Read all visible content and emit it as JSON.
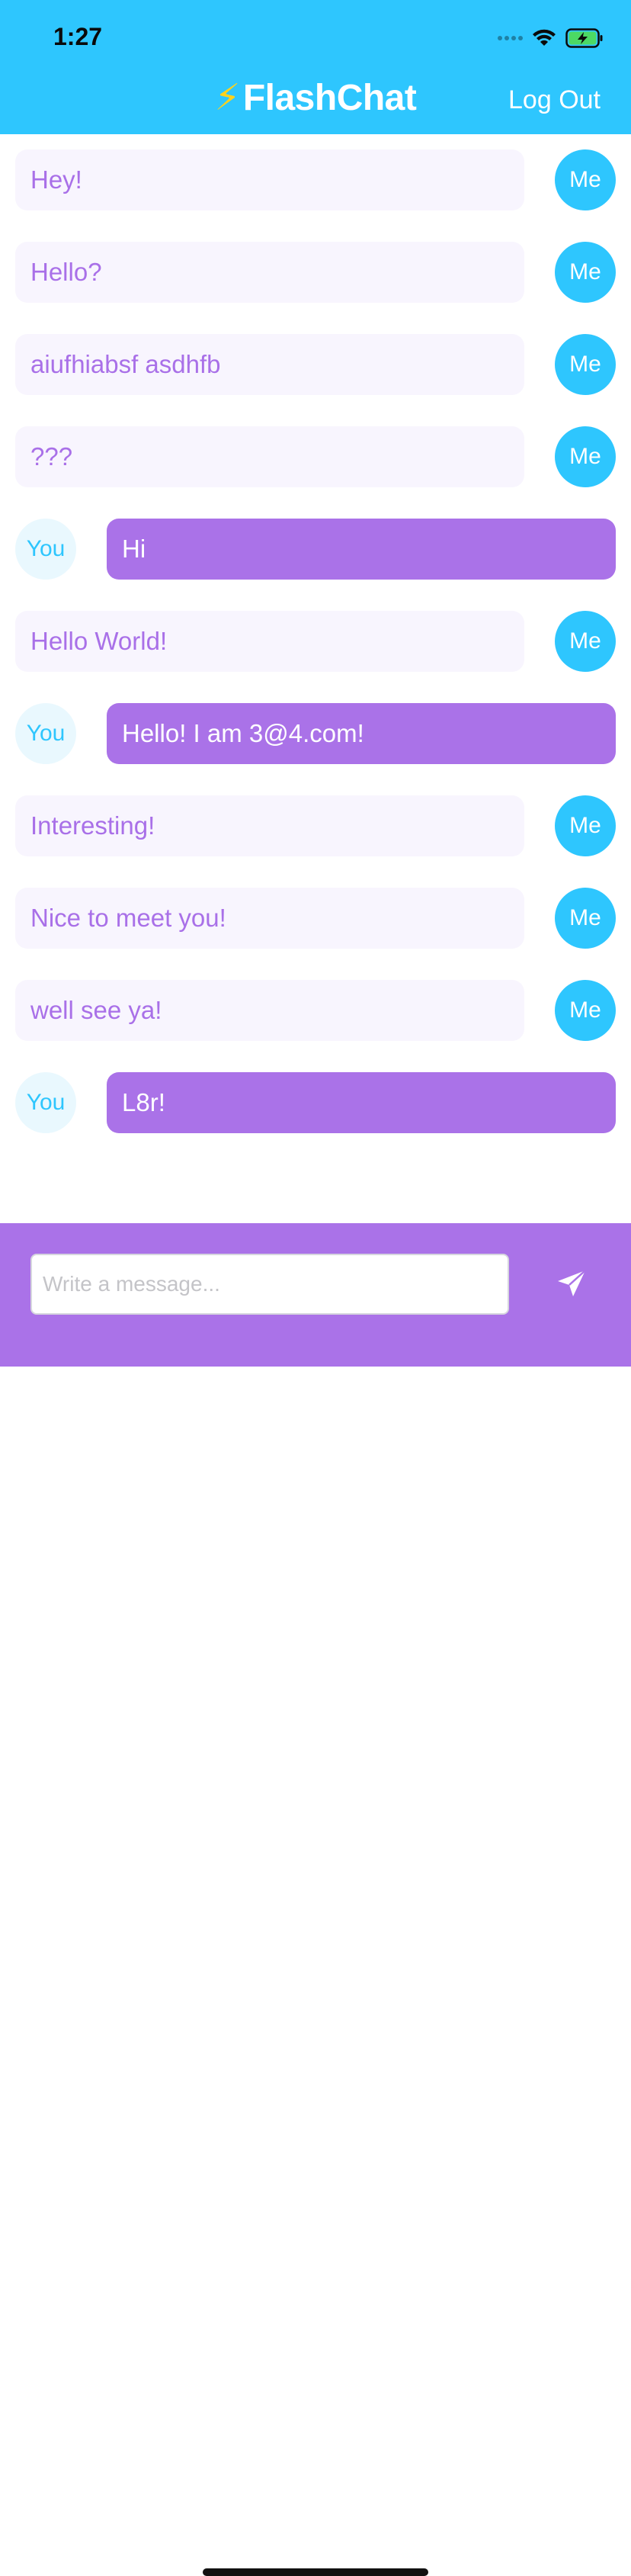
{
  "status_bar": {
    "time": "1:27",
    "icons": [
      "signal-icon",
      "wifi-icon",
      "battery-charging-icon"
    ]
  },
  "nav": {
    "title_icon": "⚡",
    "title": "FlashChat",
    "logout_label": "Log Out"
  },
  "colors": {
    "brand_blue": "#2ec6fe",
    "brand_purple": "#aa72e8",
    "bubble_light": "#f8f5fe",
    "title_bolt": "#ffd21c"
  },
  "messages": [
    {
      "sender": "me",
      "avatar": "Me",
      "text": "Hey!"
    },
    {
      "sender": "me",
      "avatar": "Me",
      "text": "Hello?"
    },
    {
      "sender": "me",
      "avatar": "Me",
      "text": " aiufhiabsf asdhfb"
    },
    {
      "sender": "me",
      "avatar": "Me",
      "text": "???"
    },
    {
      "sender": "you",
      "avatar": "You",
      "text": "Hi"
    },
    {
      "sender": "me",
      "avatar": "Me",
      "text": "Hello World!"
    },
    {
      "sender": "you",
      "avatar": "You",
      "text": "Hello! I am 3@4.com!"
    },
    {
      "sender": "me",
      "avatar": "Me",
      "text": "Interesting!"
    },
    {
      "sender": "me",
      "avatar": "Me",
      "text": "Nice to meet you!"
    },
    {
      "sender": "me",
      "avatar": "Me",
      "text": "well see ya!"
    },
    {
      "sender": "you",
      "avatar": "You",
      "text": "L8r!"
    }
  ],
  "composer": {
    "placeholder": "Write a message...",
    "value": "",
    "send_icon": "paper-plane-icon"
  }
}
